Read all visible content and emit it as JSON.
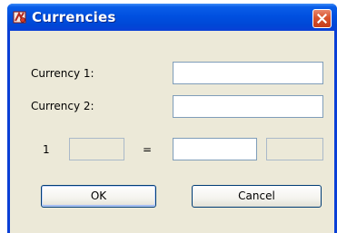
{
  "window": {
    "title": "Currencies",
    "app_icon": "currency-app-icon",
    "close_icon": "close-icon"
  },
  "form": {
    "currency1_label": "Currency 1:",
    "currency1_value": "",
    "currency2_label": "Currency 2:",
    "currency2_value": "",
    "rate_amount_label": "1",
    "rate_from_value": "",
    "equals_label": "=",
    "rate_result_value": "",
    "rate_to_value": ""
  },
  "buttons": {
    "ok_label": "OK",
    "cancel_label": "Cancel"
  },
  "colors": {
    "titlebar": "#0050e0",
    "client_background": "#ece9d8",
    "field_border": "#7f9db9",
    "close_button": "#d9532e"
  }
}
